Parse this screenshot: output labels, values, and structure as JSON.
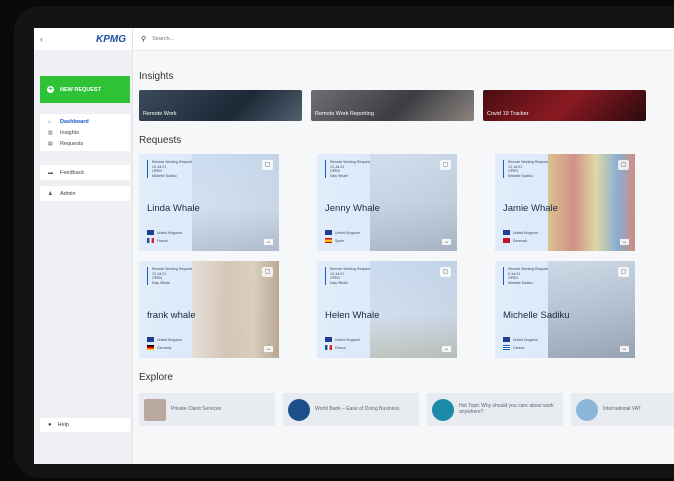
{
  "sidebar": {
    "back": "‹",
    "logo": "KPMG",
    "new_request": "NEW REQUEST",
    "items": [
      {
        "label": "Dashboard",
        "icon": "home-icon"
      },
      {
        "label": "Insights",
        "icon": "chart-icon"
      },
      {
        "label": "Requests",
        "icon": "file-icon"
      }
    ],
    "feedback": "Feedback",
    "admin": "Admin",
    "help": "Help"
  },
  "search": {
    "placeholder": "Search..."
  },
  "insights": {
    "title": "Insights",
    "cards": [
      "Remote Work",
      "Remote Work Reporting",
      "Covid 19 Tracker"
    ]
  },
  "requests": {
    "title": "Requests",
    "cards": [
      {
        "meta": [
          "Remote Working Request",
          "13 Jul 21",
          "OPEN",
          "Michelle Sadiku"
        ],
        "name": "Linda Whale",
        "origin": "United Kingdom",
        "dest": "France"
      },
      {
        "meta": [
          "Remote Working Request",
          "13 Jul 21",
          "OPEN",
          "Katy Whale"
        ],
        "name": "Jenny Whale",
        "origin": "United Kingdom",
        "dest": "Spain"
      },
      {
        "meta": [
          "Remote Working Request",
          "13 Jul 21",
          "OPEN",
          "Michelle Sadiku"
        ],
        "name": "Jamie Whale",
        "origin": "United Kingdom",
        "dest": "Denmark"
      },
      {
        "meta": [
          "Remote Working Request",
          "13 Jul 21",
          "OPEN",
          "Katy Whale"
        ],
        "name": "frank whale",
        "origin": "United Kingdom",
        "dest": "Germany"
      },
      {
        "meta": [
          "Remote Working Request",
          "13 Jul 21",
          "OPEN",
          "Katy Whale"
        ],
        "name": "Helen Whale",
        "origin": "United Kingdom",
        "dest": "France"
      },
      {
        "meta": [
          "Remote Working Request",
          "8 Jul 21",
          "OPEN",
          "Michelle Sadiku"
        ],
        "name": "Michelle Sadiku",
        "origin": "United Kingdom",
        "dest": "Greece"
      }
    ]
  },
  "explore": {
    "title": "Explore",
    "items": [
      "Private Client Services",
      "World Bank – Ease of Doing Business",
      "Hot Topic Why should you care about work anywhere?",
      "International VAT"
    ]
  },
  "colors": {
    "accent": "#1a58c9",
    "new_request": "#2ec336"
  }
}
